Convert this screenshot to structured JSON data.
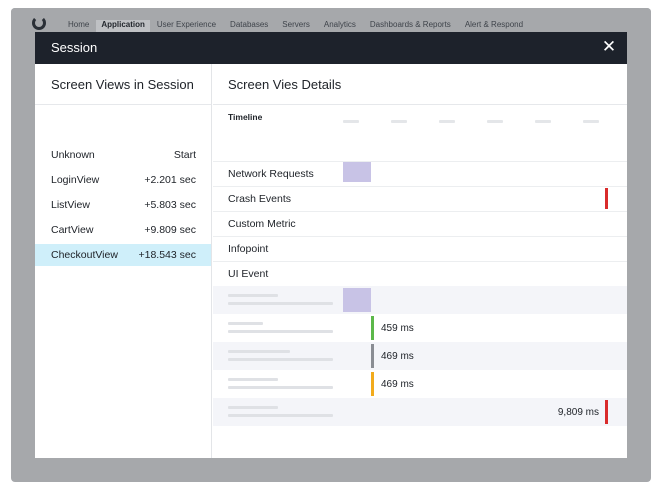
{
  "nav": {
    "items": [
      {
        "label": "Home",
        "active": false
      },
      {
        "label": "Application",
        "active": true
      },
      {
        "label": "User Experience",
        "active": false
      },
      {
        "label": "Databases",
        "active": false
      },
      {
        "label": "Servers",
        "active": false
      },
      {
        "label": "Analytics",
        "active": false
      },
      {
        "label": "Dashboards & Reports",
        "active": false
      },
      {
        "label": "Alert & Respond",
        "active": false
      }
    ]
  },
  "modal": {
    "title": "Session",
    "close_icon": "close-icon"
  },
  "left": {
    "title": "Screen Views in Session",
    "views": [
      {
        "name": "Unknown",
        "time": "Start",
        "selected": false
      },
      {
        "name": "LoginView",
        "time": "+2.201 sec",
        "selected": false
      },
      {
        "name": "ListView",
        "time": "+5.803 sec",
        "selected": false
      },
      {
        "name": "CartView",
        "time": "+9.809 sec",
        "selected": false
      },
      {
        "name": "CheckoutView",
        "time": "+18.543 sec",
        "selected": true
      }
    ]
  },
  "right": {
    "title": "Screen Vies Details",
    "timeline_label": "Timeline",
    "rows": [
      {
        "label": "Network Requests"
      },
      {
        "label": "Crash Events"
      },
      {
        "label": "Custom Metric"
      },
      {
        "label": "Infopoint"
      },
      {
        "label": "UI Event"
      }
    ],
    "details": [
      {
        "value": ""
      },
      {
        "value": "459 ms"
      },
      {
        "value": "469 ms"
      },
      {
        "value": "469 ms"
      },
      {
        "value": "9,809 ms"
      }
    ]
  },
  "colors": {
    "header": "#1d222b",
    "selected_row": "#cfeffa",
    "network_bar": "#c8c3e6",
    "crash": "#d92b2b",
    "green": "#5cb84a",
    "gray": "#8a8d93",
    "amber": "#f2ab1c"
  }
}
